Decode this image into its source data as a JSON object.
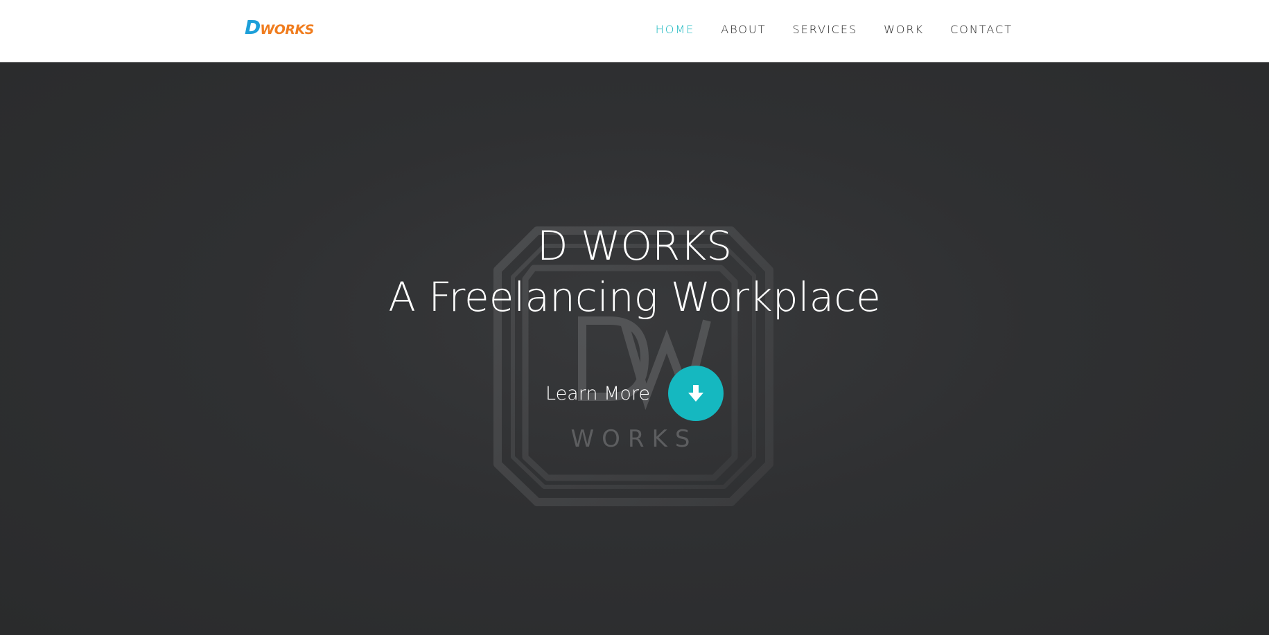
{
  "header": {
    "logo": {
      "letter": "D",
      "rest": "WORKS",
      "letter_color": "#1c9fd9",
      "rest_color": "#f07d1f"
    },
    "nav": [
      {
        "label": "HOME",
        "active": true
      },
      {
        "label": "ABOUT",
        "active": false
      },
      {
        "label": "SERVICES",
        "active": false
      },
      {
        "label": "WORK",
        "active": false
      },
      {
        "label": "CONTACT",
        "active": false
      }
    ]
  },
  "hero": {
    "title_line1": "D WORKS",
    "title_line2": "A Freelancing Workplace",
    "cta_label": "Learn More",
    "cta_icon": "arrow-down-icon",
    "emblem_text": "WORKS",
    "accent": "#15b8c0"
  }
}
